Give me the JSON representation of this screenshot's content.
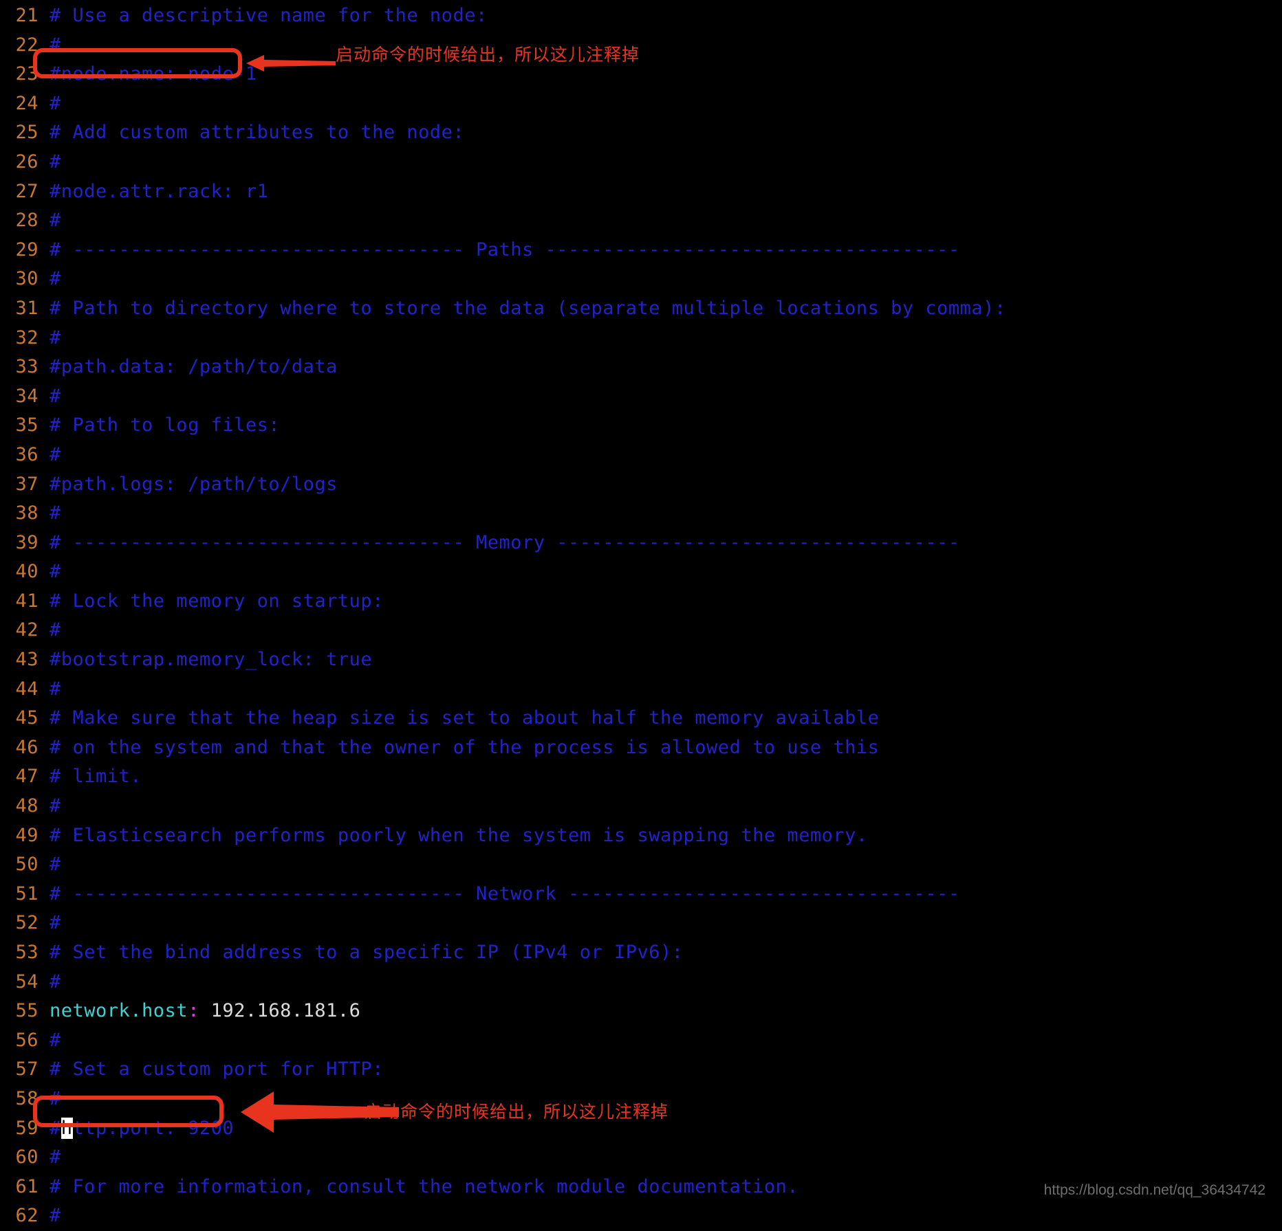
{
  "editor": {
    "background_color": "#000000",
    "line_number_color": "#c87832",
    "comment_color": "#2222cc",
    "key_color": "#3fd0d0",
    "colon_color": "#d93fd9",
    "value_color": "#dcdcdc",
    "annotation_color": "#e8341f",
    "cursor_char": "h"
  },
  "lines": [
    {
      "num": "21",
      "text": "# Use a descriptive name for the node:"
    },
    {
      "num": "22",
      "text": "#"
    },
    {
      "num": "23",
      "text": "#node.name: node-1"
    },
    {
      "num": "24",
      "text": "#"
    },
    {
      "num": "25",
      "text": "# Add custom attributes to the node:"
    },
    {
      "num": "26",
      "text": "#"
    },
    {
      "num": "27",
      "text": "#node.attr.rack: r1"
    },
    {
      "num": "28",
      "text": "#"
    },
    {
      "num": "29",
      "text": "# ---------------------------------- Paths ------------------------------------"
    },
    {
      "num": "30",
      "text": "#"
    },
    {
      "num": "31",
      "text": "# Path to directory where to store the data (separate multiple locations by comma):"
    },
    {
      "num": "32",
      "text": "#"
    },
    {
      "num": "33",
      "text": "#path.data: /path/to/data"
    },
    {
      "num": "34",
      "text": "#"
    },
    {
      "num": "35",
      "text": "# Path to log files:"
    },
    {
      "num": "36",
      "text": "#"
    },
    {
      "num": "37",
      "text": "#path.logs: /path/to/logs"
    },
    {
      "num": "38",
      "text": "#"
    },
    {
      "num": "39",
      "text": "# ---------------------------------- Memory -----------------------------------"
    },
    {
      "num": "40",
      "text": "#"
    },
    {
      "num": "41",
      "text": "# Lock the memory on startup:"
    },
    {
      "num": "42",
      "text": "#"
    },
    {
      "num": "43",
      "text": "#bootstrap.memory_lock: true"
    },
    {
      "num": "44",
      "text": "#"
    },
    {
      "num": "45",
      "text": "# Make sure that the heap size is set to about half the memory available"
    },
    {
      "num": "46",
      "text": "# on the system and that the owner of the process is allowed to use this"
    },
    {
      "num": "47",
      "text": "# limit."
    },
    {
      "num": "48",
      "text": "#"
    },
    {
      "num": "49",
      "text": "# Elasticsearch performs poorly when the system is swapping the memory."
    },
    {
      "num": "50",
      "text": "#"
    },
    {
      "num": "51",
      "text": "# ---------------------------------- Network ----------------------------------"
    },
    {
      "num": "52",
      "text": "#"
    },
    {
      "num": "53",
      "text": "# Set the bind address to a specific IP (IPv4 or IPv6):"
    },
    {
      "num": "54",
      "text": "#"
    },
    {
      "num": "55",
      "text": "network.host: 192.168.181.6",
      "kind": "setting",
      "key": "network.host",
      "colon": ":",
      "value": " 192.168.181.6"
    },
    {
      "num": "56",
      "text": "#"
    },
    {
      "num": "57",
      "text": "# Set a custom port for HTTP:"
    },
    {
      "num": "58",
      "text": "#"
    },
    {
      "num": "59",
      "text": "#http.port: 9200",
      "kind": "cursor",
      "before": "#",
      "cursor": "h",
      "after": "ttp.port: 9200"
    },
    {
      "num": "60",
      "text": "#"
    },
    {
      "num": "61",
      "text": "# For more information, consult the network module documentation."
    },
    {
      "num": "62",
      "text": "#"
    }
  ],
  "annotations": [
    {
      "id": "node-name",
      "text": "启动命令的时候给出，所以这儿注释掉",
      "target_line": "23",
      "boxed_text": "#node.name: node-1"
    },
    {
      "id": "http-port",
      "text": "启动命令的时候给出，所以这儿注释掉",
      "target_line": "59",
      "boxed_text": "#http.port: 9200"
    }
  ],
  "watermark": {
    "text": "https://blog.csdn.net/qq_36434742"
  }
}
